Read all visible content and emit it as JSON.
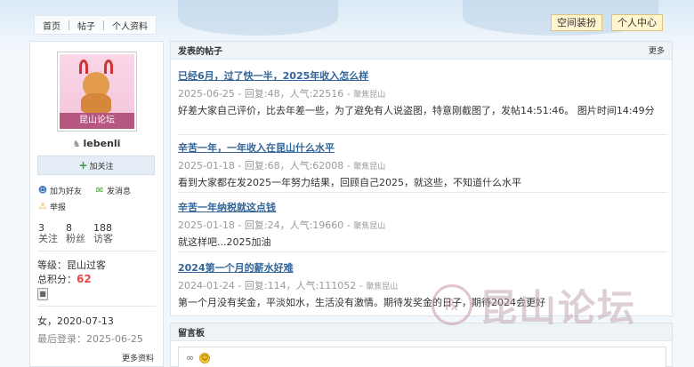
{
  "nav": {
    "items": [
      "首页",
      "帖子",
      "个人资料"
    ]
  },
  "top_buttons": {
    "space_decoration": "空间装扮",
    "personal_center": "个人中心"
  },
  "profile": {
    "avatar_label": "昆山论坛",
    "username": "lebenli",
    "follow_label": "加关注",
    "add_friend_label": "加为好友",
    "message_label": "发消息",
    "report_label": "举报",
    "stats": [
      {
        "num": "3",
        "label": "关注"
      },
      {
        "num": "8",
        "label": "粉丝"
      },
      {
        "num": "188",
        "label": "访客"
      }
    ],
    "level": "等级：昆山过客",
    "credits_label": "总积分：",
    "credits_value": "62",
    "gender_date": "女，2020-07-13",
    "last_login": "最后登录：2025-06-25",
    "more_profile": "更多资料"
  },
  "posts_panel": {
    "title": "发表的帖子",
    "more": "更多",
    "posts": [
      {
        "title": "已经6月，过了快一半，2025年收入怎么样",
        "meta": "2025-06-25 - 回复:48，人气:22516 - ",
        "forum": "聚焦昆山",
        "excerpt": "好差大家自己评价，比去年差一些，为了避免有人说盗图，特意刚截图了，发帖14:51:46。 图片时间14:49分"
      },
      {
        "title": "辛苦一年，一年收入在昆山什么水平",
        "meta": "2025-01-18 - 回复:68，人气:62008 - ",
        "forum": "聚焦昆山",
        "excerpt": "看到大家都在发2025一年努力结果，回顾自己2025，就这些，不知道什么水平"
      },
      {
        "title": "辛苦一年纳税就这点钱",
        "meta": "2025-01-18 - 回复:24，人气:19660 - ",
        "forum": "聚焦昆山",
        "excerpt": "就这样吧...2025加油"
      },
      {
        "title": "2024第一个月的薪水好难",
        "meta": "2024-01-24 - 回复:114，人气:111052 - ",
        "forum": "聚焦昆山",
        "excerpt": "第一个月没有奖金，平淡如水，生活没有激情。期待发奖金的日子，期待2024会更好"
      }
    ]
  },
  "guestbook": {
    "title": "留言板"
  },
  "watermark": {
    "text": "昆山论坛"
  },
  "icons": [
    "user-icon",
    "plus-icon",
    "add-friend-icon",
    "message-icon",
    "warning-icon",
    "medal-icon",
    "link-icon",
    "smile-icon"
  ]
}
